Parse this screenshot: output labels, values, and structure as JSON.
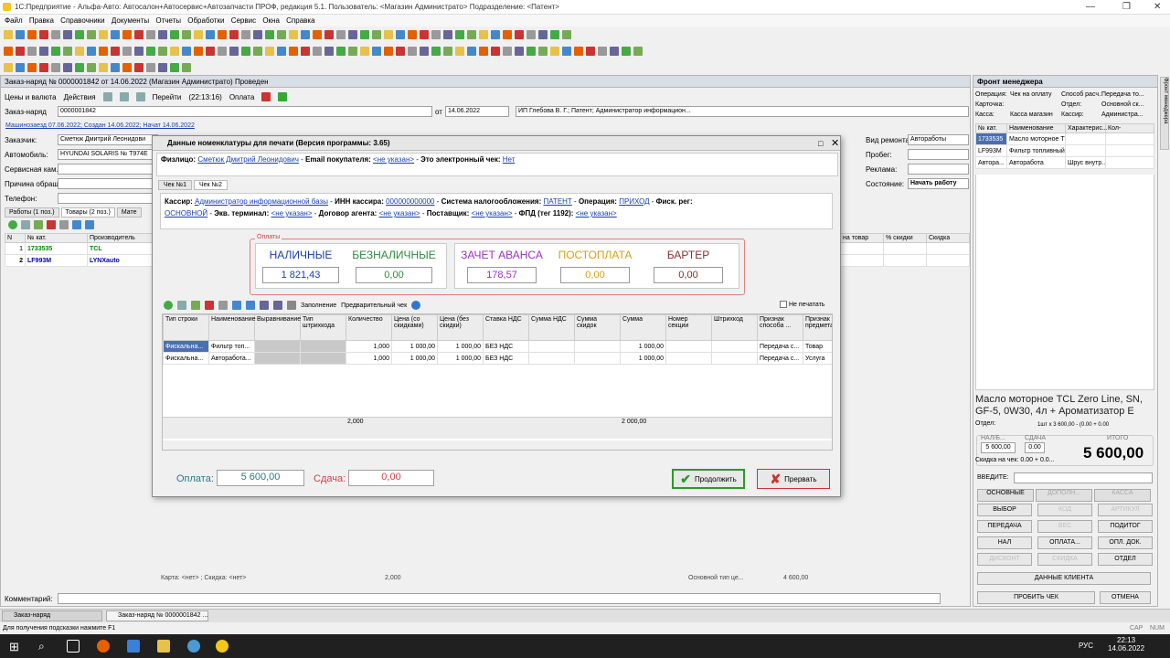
{
  "window": {
    "title": "1С:Предприятие - Альфа-Авто: Автосалон+Автосервис+Автозапчасти ПРОФ, редакция 5.1.   Пользователь: <Магазин Администрато>   Подразделение: <Патент>"
  },
  "menu": [
    "Файл",
    "Правка",
    "Справочники",
    "Документы",
    "Отчеты",
    "Обработки",
    "Сервис",
    "Окна",
    "Справка"
  ],
  "doc": {
    "title": "Заказ-наряд № 0000001842 от 14.06.2022 (Магазин Администрато) Проведен",
    "toolbar": {
      "prices": "Цены и валюта",
      "actions": "Действия",
      "goto": "Перейти",
      "time": "(22:13:16)",
      "payment": "Оплата"
    },
    "number_label": "Заказ-наряд",
    "number": "0000001842",
    "date_label": "от",
    "date": "14.06.2022",
    "org": "ИП Глебова В. Г.; Патент; Администратор информацион...",
    "info_link": "Машинозаезд 07.06.2022; Создан 14.06.2022; Начат 14.06.2022",
    "fields": {
      "customer_label": "Заказчик:",
      "customer": "Сметюк Дмитрий Леонидови",
      "car_label": "Автомобиль:",
      "car": "HYUNDAI SOLARIS № T974E",
      "service_label": "Сервисная кам...",
      "reason_label": "Причина обращ...",
      "phone_label": "Телефон:"
    },
    "right_fields": {
      "repair_label": "Вид ремонта:",
      "repair": "Авторaботы",
      "mileage_label": "Пробег:",
      "ad_label": "Реклама:",
      "state_label": "Состояние:",
      "state": "Начать работу"
    },
    "tabs": [
      "Работы (1 поз.)",
      "Товары (2 поз.)",
      "Мате"
    ],
    "grid_headers": [
      "N",
      "№ кат.",
      "Производитель"
    ],
    "grid_rows": [
      {
        "n": "1",
        "cat": "1733535",
        "maker": "TCL"
      },
      {
        "n": "2",
        "cat": "LF993M",
        "maker": "LYNXauto"
      }
    ],
    "right_headers": [
      "на товар",
      "% скидки",
      "Скидка"
    ],
    "bottom": {
      "card": "Карта: <нет> ; Скидка: <нет>",
      "qty": "2,000",
      "tax": "Основной тип це...",
      "sum": "4 600,00"
    },
    "comment_label": "Комментарий:"
  },
  "dialog": {
    "title": "Данные номенклатуры для печати (Версия программы: 3.65)",
    "person_label": "Физлицо:",
    "person": "Сметюк Дмитрий Леонидович",
    "email_label": "Email покупателя:",
    "email": "<не указан>",
    "echeck_label": "Это электронный чек:",
    "echeck": "Нет",
    "tabs": [
      "Чек №1",
      "Чек №2"
    ],
    "cashier_label": "Кассир:",
    "cashier": "Администратор информационной базы",
    "inn_label": "ИНН кассира:",
    "inn": "000000000000",
    "tax_label": "Система налогообложения:",
    "tax": "ПАТЕНТ",
    "op_label": "Операция:",
    "op": "ПРИХОД",
    "fisc_label": "Фиск. рег:",
    "fisc": "ОСНОВНОЙ",
    "terminal_label": "Экв. терминал:",
    "terminal": "<не указан>",
    "agent_label": "Договор агента:",
    "agent": "<не указан>",
    "supplier_label": "Поставщик:",
    "supplier": "<не указан>",
    "fpd_label": "ФПД (тег 1192):",
    "fpd": "<не указан>",
    "payments_label": "Оплаты",
    "payments": [
      {
        "label": "НАЛИЧНЫЕ",
        "value": "1 821,43",
        "color": "#1a3fb0"
      },
      {
        "label": "БЕЗНАЛИЧНЫЕ",
        "value": "0,00",
        "color": "#2e8b3d"
      },
      {
        "label": "ЗАЧЕТ АВАНСА",
        "value": "178,57",
        "color": "#9b30c8"
      },
      {
        "label": "ПОСТОПЛАТА",
        "value": "0,00",
        "color": "#d4a017"
      },
      {
        "label": "БАРТЕР",
        "value": "0,00",
        "color": "#8b2e2e"
      }
    ],
    "fill_label": "Заполнение",
    "preview_label": "Предварительный чек",
    "noprint_label": "Не печатать",
    "grid_headers": [
      "Тип строки",
      "Наименование",
      "Выравнивание",
      "Тип штрихкода",
      "Количество",
      "Цена (со скидками)",
      "Цена (без скидки)",
      "Ставка НДС",
      "Сумма НДС",
      "Сумма скидок",
      "Сумма",
      "Номер секции",
      "Штрихкод",
      "Признак способа ...",
      "Признак предмета"
    ],
    "grid_rows": [
      [
        "Фискальна...",
        "Фильтр топ...",
        "",
        "",
        "1,000",
        "1 000,00",
        "1 000,00",
        "БЕЗ НДС",
        "",
        "",
        "1 000,00",
        "",
        "",
        "Передача с...",
        "Товар"
      ],
      [
        "Фискальна...",
        "Авторабота...",
        "",
        "",
        "1,000",
        "1 000,00",
        "1 000,00",
        "БЕЗ НДС",
        "",
        "",
        "1 000,00",
        "",
        "",
        "Передача с...",
        "Услуга"
      ]
    ],
    "totals": {
      "qty": "2,000",
      "sum": "2 000,00"
    },
    "pay_label": "Оплата:",
    "pay_value": "5 600,00",
    "change_label": "Сдача:",
    "change_value": "0,00",
    "continue": "Продолжить",
    "cancel": "Прервать"
  },
  "front": {
    "title": "Фронт менеджера",
    "info": [
      [
        "Операция:",
        "Чек на оплату",
        "Способ расч.:",
        "Передача то..."
      ],
      [
        "Карточка:",
        "",
        "Отдел:",
        "Основной ск..."
      ],
      [
        "Касса:",
        "Касса магазин",
        "Кассир:",
        "Администра..."
      ]
    ],
    "grid_headers": [
      "№ кат.",
      "Наименование",
      "Характерис...",
      "Кол-"
    ],
    "grid_rows": [
      [
        "1733535",
        "Масло моторное TCL Z...",
        "",
        ""
      ],
      [
        "LF993M",
        "Фильтр топливный",
        "",
        ""
      ],
      [
        "Автора...",
        "Авторабота",
        "Шрус внутр...",
        ""
      ]
    ],
    "product": "Масло моторное TCL Zero Line, SN, GF-5, 0W30, 4л + Ароматизатор E",
    "dept_label": "Отдел:",
    "dept_detail": "1шт х 3 600,00 - (0.00 + 0.00",
    "nal_label": "НАЛ/Б...",
    "nal_value": "5 600,00",
    "change_label": "СДАЧА",
    "change_value": "0.00",
    "total_label": "ИТОГО",
    "total_value": "5 600,00",
    "discount": "Скидка на чек: 0.00 + 0.0...",
    "enter_label": "ВВЕДИТЕ:",
    "tabs": [
      "ОСНОВНЫЕ",
      "ДОПОЛН...",
      "КАССА"
    ],
    "buttons": [
      [
        "ВЫБОР",
        "КОД",
        "АРТИКУЛ"
      ],
      [
        "ПЕРЕДАЧА",
        "ВЕС",
        "ПОДИТОГ"
      ],
      [
        "НАЛ",
        "ОПЛАТА...",
        "ОПЛ. ДОК."
      ],
      [
        "ДИСКОНТ",
        "СКИДКА",
        "ОТДЕЛ"
      ]
    ],
    "client_data": "ДАННЫЕ КЛИЕНТА",
    "punch": "ПРОБИТЬ ЧЕК",
    "cancel": "ОТМЕНА",
    "side_tab": "Фронт менеджера"
  },
  "taskbar_tabs": [
    "Заказ-наряд",
    "Заказ-наряд № 0000001842 ..."
  ],
  "status": {
    "hint": "Для получения подсказки нажмите F1",
    "caps": "CAP",
    "num": "NUM"
  },
  "clock": {
    "time": "22:13",
    "date": "14.06.2022",
    "lang": "РУС"
  }
}
